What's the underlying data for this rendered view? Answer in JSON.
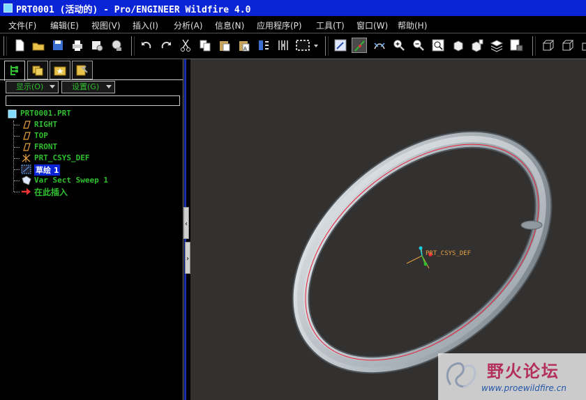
{
  "window": {
    "title": "PRT0001 (活动的) - Pro/ENGINEER Wildfire 4.0"
  },
  "menu": [
    {
      "label": "文件(F)"
    },
    {
      "label": "编辑(E)"
    },
    {
      "label": "视图(V)"
    },
    {
      "label": "插入(I)"
    },
    {
      "label": "分析(A)"
    },
    {
      "label": "信息(N)"
    },
    {
      "label": "应用程序(P)"
    },
    {
      "label": "工具(T)"
    },
    {
      "label": "窗口(W)"
    },
    {
      "label": "帮助(H)"
    }
  ],
  "toolbar_icons": [
    "new-icon",
    "open-icon",
    "save-icon",
    "print-icon",
    "email-icon",
    "send-icon",
    "undo-icon",
    "redo-icon",
    "cut-icon",
    "copy-icon",
    "paste-icon",
    "paste-special-icon",
    "regenerate-icon",
    "regen-manager-icon",
    "select-box-icon",
    "repaint-icon",
    "spin-center-icon",
    "orient-icon",
    "zoom-in-icon",
    "zoom-out-icon",
    "refit-icon",
    "reorient-icon",
    "saved-views-icon",
    "layers-icon",
    "view-manager-icon",
    "wireframe-icon",
    "hidden-line-icon"
  ],
  "panel": {
    "tabs": [
      "model-tree-tab",
      "folder-browser-tab",
      "favorites-tab",
      "connections-tab"
    ],
    "show_label": "显示(O)",
    "settings_label": "设置(G)"
  },
  "tree": {
    "root": "PRT0001.PRT",
    "items": [
      {
        "label": "RIGHT",
        "icon": "datum-plane-icon"
      },
      {
        "label": "TOP",
        "icon": "datum-plane-icon"
      },
      {
        "label": "FRONT",
        "icon": "datum-plane-icon"
      },
      {
        "label": "PRT_CSYS_DEF",
        "icon": "coordinate-system-icon"
      },
      {
        "label": "草绘 1",
        "icon": "sketch-icon",
        "selected": true
      },
      {
        "label": "Var Sect Sweep 1",
        "icon": "sweep-icon"
      },
      {
        "label": "在此插入",
        "icon": "insert-here-icon"
      }
    ]
  },
  "viewport": {
    "csys_label": "PRT_CSYS_DEF",
    "background": "#333130",
    "model_color": "#c9ced3",
    "sketch_color": "#e8223a"
  },
  "watermark": {
    "title": "野火论坛",
    "url": "www.proewildfire.cn"
  }
}
